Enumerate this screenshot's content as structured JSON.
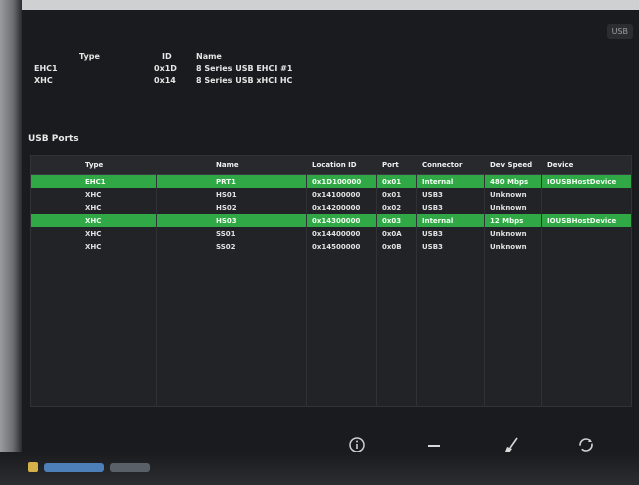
{
  "top_tab": {
    "label": "USB"
  },
  "controllers": {
    "headers": {
      "type": "Type",
      "id": "ID",
      "name": "Name"
    },
    "rows": [
      {
        "type": "EHC1",
        "id": "0x1D",
        "name": "8 Series USB EHCI #1"
      },
      {
        "type": "XHC",
        "id": "0x14",
        "name": "8 Series USB xHCI HC"
      }
    ]
  },
  "ports_section": {
    "title": "USB Ports"
  },
  "ports": {
    "headers": {
      "type": "Type",
      "name": "Name",
      "location": "Location ID",
      "port": "Port",
      "connector": "Connector",
      "speed": "Dev Speed",
      "device": "Device"
    },
    "rows": [
      {
        "type": "EHC1",
        "name": "PRT1",
        "location": "0x1D100000",
        "port": "0x01",
        "connector": "Internal",
        "speed": "480 Mbps",
        "device": "IOUSBHostDevice",
        "highlight": true
      },
      {
        "type": "XHC",
        "name": "HS01",
        "location": "0x14100000",
        "port": "0x01",
        "connector": "USB3",
        "speed": "Unknown",
        "device": "",
        "highlight": false
      },
      {
        "type": "XHC",
        "name": "HS02",
        "location": "0x14200000",
        "port": "0x02",
        "connector": "USB3",
        "speed": "Unknown",
        "device": "",
        "highlight": false
      },
      {
        "type": "XHC",
        "name": "HS03",
        "location": "0x14300000",
        "port": "0x03",
        "connector": "Internal",
        "speed": "12 Mbps",
        "device": "IOUSBHostDevice",
        "highlight": true
      },
      {
        "type": "XHC",
        "name": "SS01",
        "location": "0x14400000",
        "port": "0x0A",
        "connector": "USB3",
        "speed": "Unknown",
        "device": "",
        "highlight": false
      },
      {
        "type": "XHC",
        "name": "SS02",
        "location": "0x14500000",
        "port": "0x0B",
        "connector": "USB3",
        "speed": "Unknown",
        "device": "",
        "highlight": false
      }
    ]
  },
  "toolbar": {
    "icons": [
      "info-icon",
      "minus-icon",
      "clean-icon",
      "refresh-icon"
    ]
  },
  "colors": {
    "highlight": "#2fa845",
    "background": "#222327"
  }
}
